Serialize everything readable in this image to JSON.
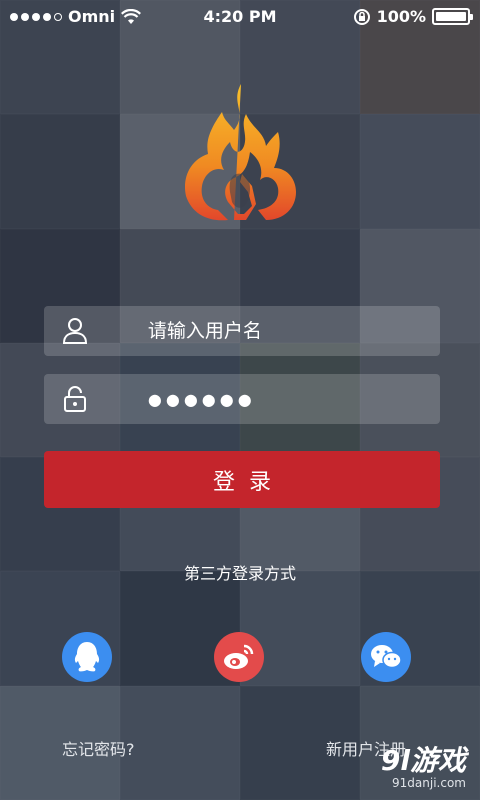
{
  "status_bar": {
    "carrier": "Omni",
    "time": "4:20 PM",
    "battery": "100%",
    "battery_level": 1.0,
    "signal_bars": 4
  },
  "background": {
    "tile_colors": [
      "#5d6470",
      "#8b8f96",
      "#6a707b",
      "#7a6b60",
      "#4e5561",
      "#9ea2a8",
      "#5b606a",
      "#6f7583",
      "#3e4450",
      "#6e717a",
      "#4f5563",
      "#8a8e97",
      "#6b707a",
      "#526070",
      "#5e6b5f",
      "#7b7f86",
      "#4f5866",
      "#6a7482",
      "#8d949d",
      "#727780",
      "#5a6573",
      "#3f4a58",
      "#6a7684",
      "#55616d",
      "#8894a0",
      "#6d7986",
      "#4e5a66",
      "#707a84"
    ]
  },
  "logo": {
    "icon": "flame-logo-icon",
    "colors": {
      "outer": "#f2a51c",
      "inner": "#e2472b"
    }
  },
  "form": {
    "username": {
      "icon": "user-icon",
      "placeholder": "请输入用户名",
      "value": ""
    },
    "password": {
      "icon": "lock-icon",
      "value": "●●●●●●"
    },
    "login_label": "登录",
    "login_color": "#c4252c"
  },
  "third_party": {
    "title": "第三方登录方式",
    "providers": [
      {
        "name": "qq",
        "icon": "qq-icon",
        "color": "#3c8ef0"
      },
      {
        "name": "weibo",
        "icon": "weibo-icon",
        "color": "#e34b4b"
      },
      {
        "name": "wechat",
        "icon": "wechat-icon",
        "color": "#3c8ef0"
      }
    ]
  },
  "footer": {
    "forgot": "忘记密码?",
    "register": "新用户注册"
  },
  "watermark": {
    "main": "9l游戏",
    "sub": "91danji.com"
  }
}
